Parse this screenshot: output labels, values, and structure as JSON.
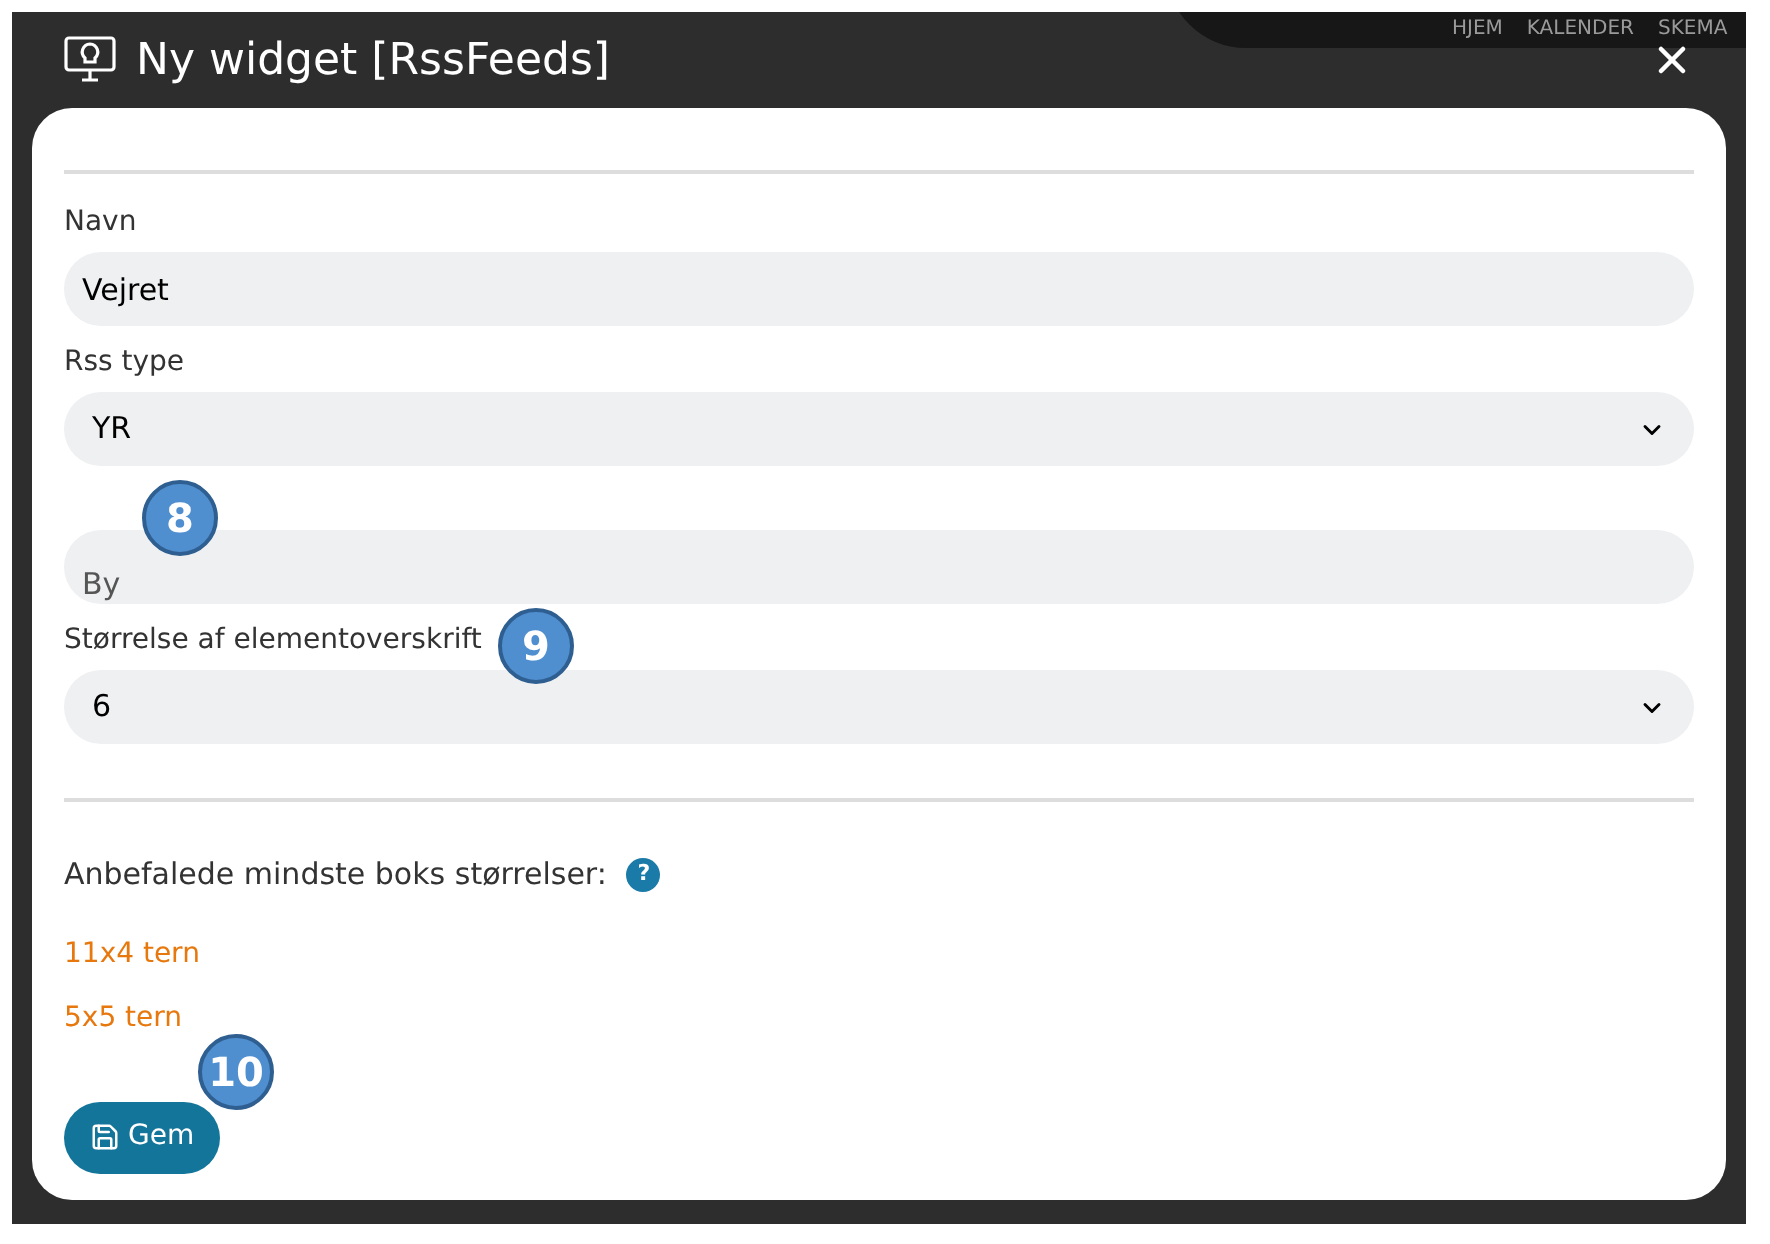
{
  "background": {
    "nav": [
      "HJEM",
      "KALENDER",
      "SKEMA"
    ]
  },
  "dialog": {
    "title": "Ny widget [RssFeeds]",
    "fields": [
      {
        "kind": "text",
        "label": "Navn",
        "value": "Vejret"
      },
      {
        "kind": "select",
        "label": "Rss type",
        "value": "YR"
      },
      {
        "kind": "text",
        "placeholder": "By"
      },
      {
        "kind": "select",
        "label": "Størrelse af elementoverskrift",
        "value": "6"
      }
    ],
    "recommend_label": "Anbefalede mindste boks størrelser:",
    "help_icon": "?",
    "sizes": [
      "11x4 tern",
      "5x5 tern"
    ],
    "save_button": "Gem"
  },
  "markers": [
    "8",
    "9",
    "10"
  ]
}
